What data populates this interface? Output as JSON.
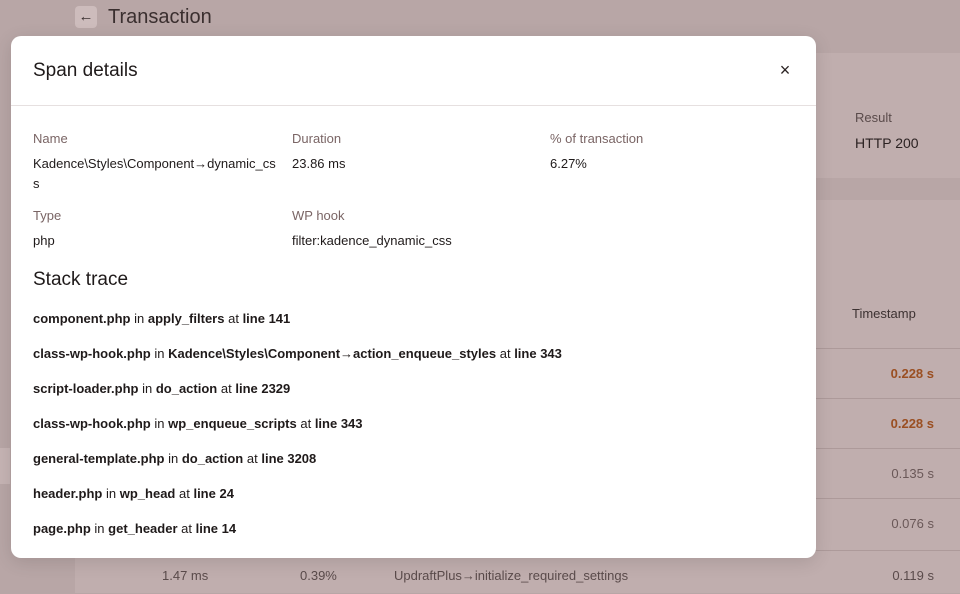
{
  "background": {
    "header": {
      "back_icon": "arrow-left-icon",
      "back_glyph": "←",
      "title": "Transaction"
    },
    "summary": {
      "result_label": "Result",
      "result_value": "HTTP 200"
    },
    "table": {
      "timestamp_header": "Timestamp",
      "rows": [
        {
          "timestamp": "0.228 s",
          "highlight": true
        },
        {
          "timestamp": "0.228 s",
          "highlight": true
        },
        {
          "timestamp": "0.135 s",
          "highlight": false
        },
        {
          "timestamp": "0.076 s",
          "highlight": false
        }
      ],
      "last_row": {
        "duration": "1.47 ms",
        "percent": "0.39%",
        "name": "UpdraftPlus→initialize_required_settings",
        "timestamp": "0.119 s"
      }
    }
  },
  "modal": {
    "title": "Span details",
    "close_icon": "close-icon",
    "close_glyph": "×",
    "fields": {
      "name": {
        "label": "Name",
        "value": "Kadence\\Styles\\Component→dynamic_css"
      },
      "duration": {
        "label": "Duration",
        "value": "23.86 ms"
      },
      "percent": {
        "label": "% of transaction",
        "value": "6.27%"
      },
      "type": {
        "label": "Type",
        "value": "php"
      },
      "hook": {
        "label": "WP hook",
        "value": "filter:kadence_dynamic_css"
      }
    },
    "stack_title": "Stack trace",
    "stack": [
      {
        "file": "component.php",
        "function": "apply_filters",
        "line": "line 141"
      },
      {
        "file": "class-wp-hook.php",
        "function": "Kadence\\Styles\\Component→action_enqueue_styles",
        "line": "line 343"
      },
      {
        "file": "script-loader.php",
        "function": "do_action",
        "line": "line 2329"
      },
      {
        "file": "class-wp-hook.php",
        "function": "wp_enqueue_scripts",
        "line": "line 343"
      },
      {
        "file": "general-template.php",
        "function": "do_action",
        "line": "line 3208"
      },
      {
        "file": "header.php",
        "function": "wp_head",
        "line": "line 24"
      },
      {
        "file": "page.php",
        "function": "get_header",
        "line": "line 14"
      }
    ],
    "connectors": {
      "in": "in",
      "at": "at"
    }
  }
}
